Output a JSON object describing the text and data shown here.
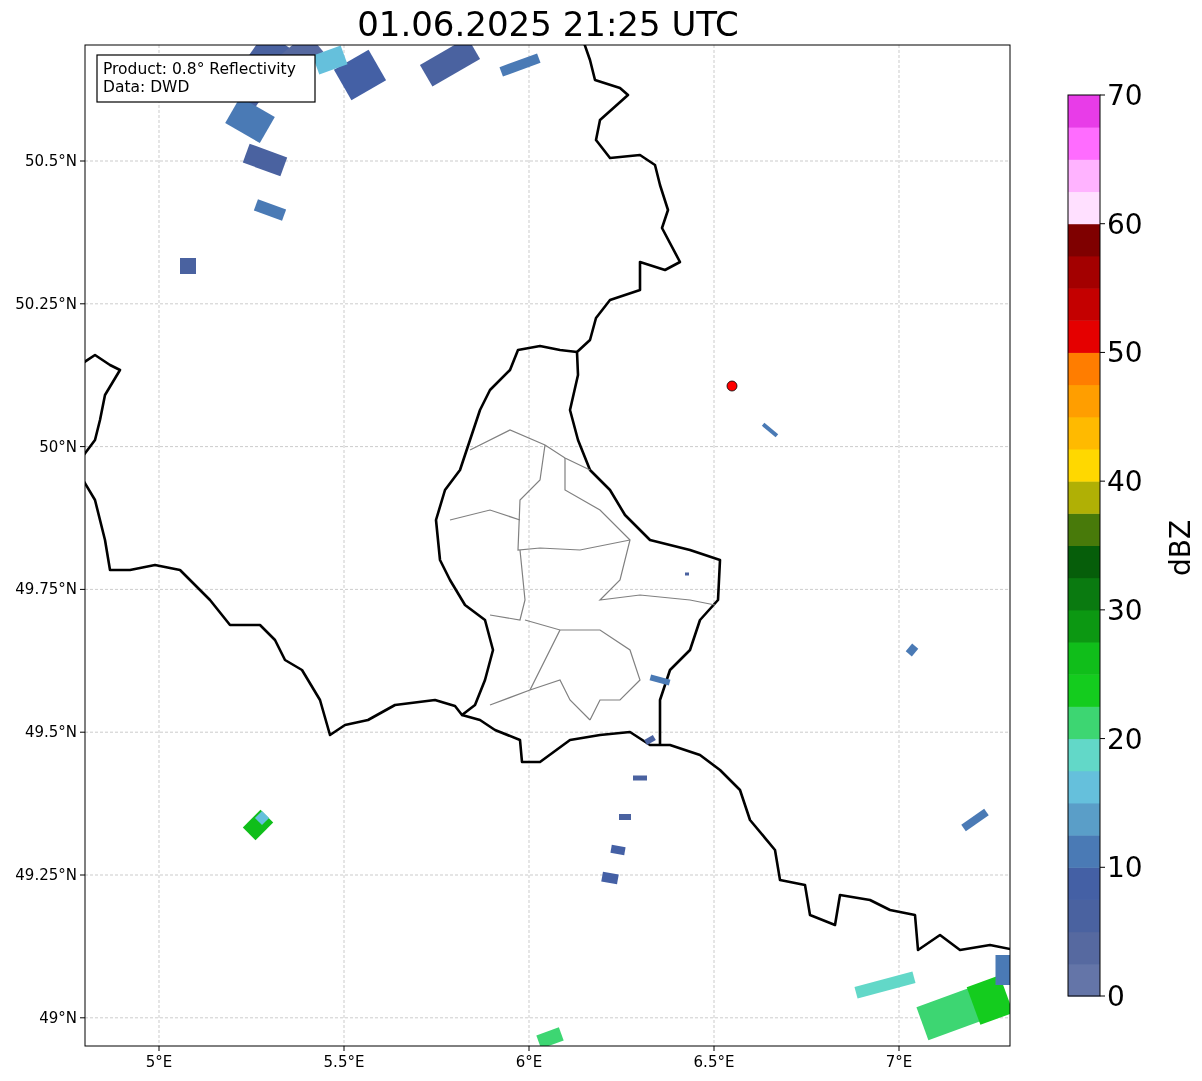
{
  "title": "01.06.2025 21:25 UTC",
  "info_box": {
    "lines": [
      "Product: 0.8° Reflectivity",
      "Data: DWD"
    ]
  },
  "map": {
    "x_ticks": [
      "5°E",
      "5.5°E",
      "6°E",
      "6.5°E",
      "7°E"
    ],
    "y_ticks": [
      "50.5°N",
      "50.25°N",
      "50°N",
      "49.75°N",
      "49.5°N",
      "49.25°N",
      "49°N"
    ],
    "marker": {
      "color": "#ff0000"
    }
  },
  "colorbar": {
    "label": "dBZ",
    "ticks": [
      "70",
      "60",
      "50",
      "40",
      "30",
      "20",
      "10",
      "0"
    ],
    "bins": [
      {
        "color": "#6475a8"
      },
      {
        "color": "#5669a0"
      },
      {
        "color": "#4a62a0"
      },
      {
        "color": "#4460a5"
      },
      {
        "color": "#4a7ab5"
      },
      {
        "color": "#5a9ec8"
      },
      {
        "color": "#65c0dc"
      },
      {
        "color": "#62d8c8"
      },
      {
        "color": "#3dd672"
      },
      {
        "color": "#14cc1e"
      },
      {
        "color": "#10be1a"
      },
      {
        "color": "#0c9812"
      },
      {
        "color": "#0a7a10"
      },
      {
        "color": "#065e0a"
      },
      {
        "color": "#487a0a"
      },
      {
        "color": "#b0b005"
      },
      {
        "color": "#ffd800"
      },
      {
        "color": "#ffba00"
      },
      {
        "color": "#ff9e00"
      },
      {
        "color": "#ff7d00"
      },
      {
        "color": "#e50000"
      },
      {
        "color": "#c40000"
      },
      {
        "color": "#a30000"
      },
      {
        "color": "#7f0000"
      },
      {
        "color": "#ffe0ff"
      },
      {
        "color": "#ffb3ff"
      },
      {
        "color": "#ff6cff"
      },
      {
        "color": "#e83ce8"
      }
    ]
  }
}
